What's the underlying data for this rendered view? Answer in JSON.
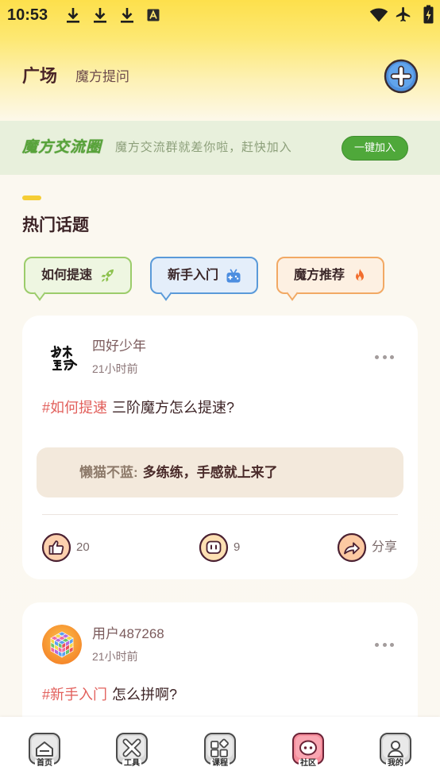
{
  "status_bar": {
    "time": "10:53",
    "left_icons": [
      "download-icon",
      "download-icon",
      "download-icon",
      "text-a-icon"
    ],
    "right_icons": [
      "wifi-icon",
      "airplane-mode-icon",
      "battery-charging-icon"
    ]
  },
  "header": {
    "title": "广场",
    "subtitle": "魔方提问",
    "action_icon": "add-circle-icon"
  },
  "banner": {
    "brand": "魔方交流圈",
    "message": "魔方交流群就差你啦，赶快加入",
    "button_label": "一键加入"
  },
  "hot_topics": {
    "title": "热门话题",
    "items": [
      {
        "label": "如何提速",
        "icon": "rocket-icon",
        "accent": "#9ccc6b"
      },
      {
        "label": "新手入门",
        "icon": "gamepad-icon",
        "accent": "#5a9ad9"
      },
      {
        "label": "魔方推荐",
        "icon": "fire-icon",
        "accent": "#f2a964"
      }
    ]
  },
  "posts": [
    {
      "author": "四好少年",
      "time": "21小时前",
      "tag": "#如何提速",
      "text": "三阶魔方怎么提速?",
      "top_comment": {
        "author": "懒猫不蓝:",
        "text": "多练练，手感就上来了"
      },
      "likes": "20",
      "comments": "9",
      "share_label": "分享",
      "more_icon": "more-icon"
    },
    {
      "author": "用户487268",
      "time": "21小时前",
      "tag": "#新手入门",
      "text": "怎么拼啊?",
      "more_icon": "more-icon"
    }
  ],
  "bottom_nav": {
    "items": [
      {
        "label": "首页",
        "icon": "home-icon",
        "active": false
      },
      {
        "label": "工具",
        "icon": "tools-icon",
        "active": false
      },
      {
        "label": "课程",
        "icon": "courses-icon",
        "active": false
      },
      {
        "label": "社区",
        "icon": "community-icon",
        "active": true
      },
      {
        "label": "我的",
        "icon": "profile-icon",
        "active": false
      }
    ]
  },
  "colors": {
    "header_yellow": "#fde04c",
    "tag_red": "#e2605c",
    "banner_green": "#4fa83a",
    "add_button_blue": "#4e8fdc",
    "active_nav_pink": "#f58b9a"
  }
}
